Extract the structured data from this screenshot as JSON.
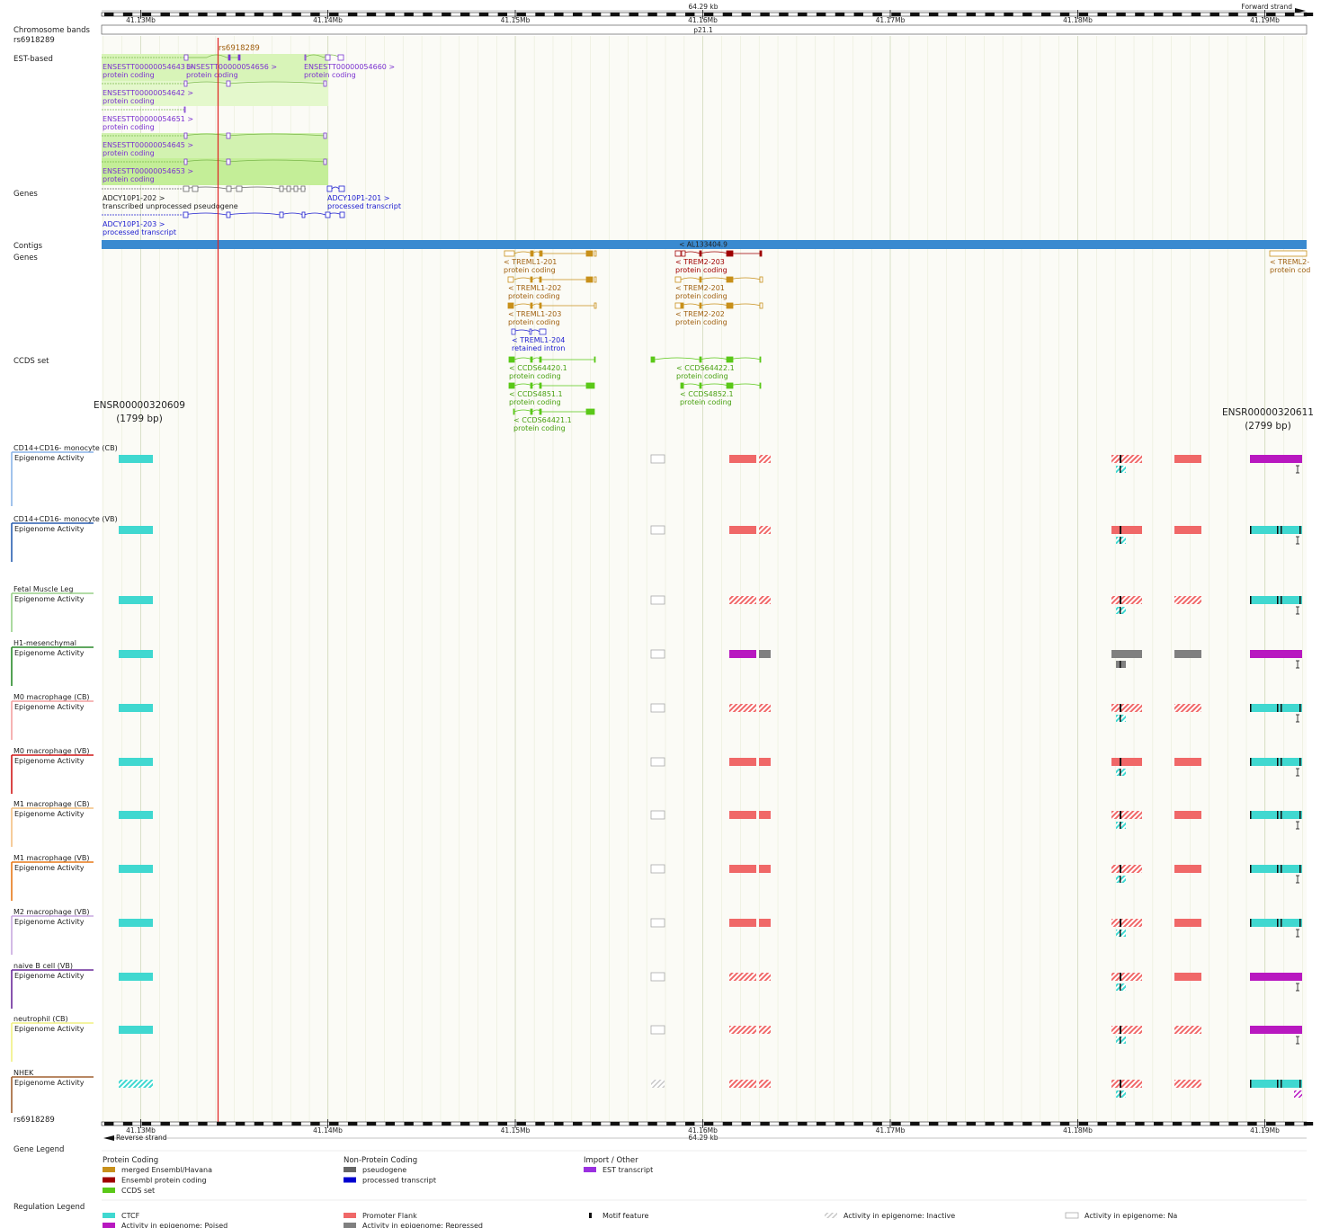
{
  "region": {
    "length_label": "64.29 kb",
    "forward_strand": "Forward strand",
    "reverse_strand": "Reverse strand",
    "band": "p21.1",
    "ticks": [
      "41.13Mb",
      "41.14Mb",
      "41.15Mb",
      "41.16Mb",
      "41.17Mb",
      "41.18Mb",
      "41.19Mb"
    ],
    "variant": "rs6918289"
  },
  "track_labels": {
    "chromosome_bands": "Chromosome bands",
    "variant": "rs6918289",
    "est": "EST-based",
    "genes": "Genes",
    "contigs": "Contigs",
    "genes2": "Genes",
    "ccds": "CCDS set",
    "variant_bottom": "rs6918289",
    "gene_legend": "Gene Legend",
    "reg_legend": "Regulation Legend",
    "epigenome_activity": "Epigenome Activity"
  },
  "est_features": [
    {
      "name": "ENSESTT00000054643 >",
      "type": "protein coding"
    },
    {
      "name": "ENSESTT00000054656 >",
      "type": "protein coding"
    },
    {
      "name": "ENSESTT00000054660 >",
      "type": "protein coding"
    },
    {
      "name": "ENSESTT00000054642 >",
      "type": "protein coding"
    },
    {
      "name": "ENSESTT00000054651 >",
      "type": "protein coding"
    },
    {
      "name": "ENSESTT00000054645 >",
      "type": "protein coding"
    },
    {
      "name": "ENSESTT00000054653 >",
      "type": "protein coding"
    }
  ],
  "genes_top": [
    {
      "name": "ADCY10P1-202 >",
      "type": "transcribed unprocessed pseudogene"
    },
    {
      "name": "ADCY10P1-201 >",
      "type": "processed transcript"
    },
    {
      "name": "ADCY10P1-203 >",
      "type": "processed transcript"
    }
  ],
  "contig": "< AL133404.9",
  "genes_bottom": [
    {
      "name": "< TREML1-201",
      "type": "protein coding"
    },
    {
      "name": "< TREML1-202",
      "type": "protein coding"
    },
    {
      "name": "< TREML1-203",
      "type": "protein coding"
    },
    {
      "name": "< TREML1-204",
      "type": "retained intron"
    },
    {
      "name": "< TREM2-203",
      "type": "protein coding"
    },
    {
      "name": "< TREM2-201",
      "type": "protein coding"
    },
    {
      "name": "< TREM2-202",
      "type": "protein coding"
    },
    {
      "name": "< TREML2-",
      "type": "protein cod"
    }
  ],
  "ccds": [
    {
      "name": "< CCDS64420.1",
      "type": "protein coding"
    },
    {
      "name": "< CCDS4851.1",
      "type": "protein coding"
    },
    {
      "name": "< CCDS64421.1",
      "type": "protein coding"
    },
    {
      "name": "< CCDS64422.1",
      "type": "protein coding"
    },
    {
      "name": "< CCDS4852.1",
      "type": "protein coding"
    }
  ],
  "regfeatures": [
    {
      "id": "ENSR00000320609",
      "size": "(1799 bp)"
    },
    {
      "id": "ENSR00000320611",
      "size": "(2799 bp)"
    }
  ],
  "epigenomes": [
    {
      "name": "CD14+CD16- monocyte (CB)",
      "color": "#8ab4e8"
    },
    {
      "name": "CD14+CD16- monocyte (VB)",
      "color": "#2a5fb0"
    },
    {
      "name": "Fetal Muscle Leg",
      "color": "#98d088"
    },
    {
      "name": "H1-mesenchymal",
      "color": "#2a8a2a"
    },
    {
      "name": "M0 macrophage (CB)",
      "color": "#f4a0a0"
    },
    {
      "name": "M0 macrophage (VB)",
      "color": "#d01818"
    },
    {
      "name": "M1 macrophage (CB)",
      "color": "#f4c080"
    },
    {
      "name": "M1 macrophage (VB)",
      "color": "#e87818"
    },
    {
      "name": "M2 macrophage (VB)",
      "color": "#c8a8e0"
    },
    {
      "name": "naive B cell (VB)",
      "color": "#6a2a9a"
    },
    {
      "name": "neutrophil (CB)",
      "color": "#f0f080"
    },
    {
      "name": "NHEK",
      "color": "#a06030"
    }
  ],
  "gene_legend": {
    "protein_coding": {
      "title": "Protein Coding",
      "items": [
        {
          "label": "merged Ensembl/Havana",
          "color": "#c8901a"
        },
        {
          "label": "Ensembl protein coding",
          "color": "#a00000"
        },
        {
          "label": "CCDS set",
          "color": "#5ac818"
        }
      ]
    },
    "non_protein_coding": {
      "title": "Non-Protein Coding",
      "items": [
        {
          "label": "pseudogene",
          "color": "#666666"
        },
        {
          "label": "processed transcript",
          "color": "#0000d0"
        }
      ]
    },
    "import_other": {
      "title": "Import / Other",
      "items": [
        {
          "label": "EST transcript",
          "color": "#9a30e0"
        }
      ]
    }
  },
  "reg_legend": [
    {
      "label": "CTCF",
      "color": "#40d8d0"
    },
    {
      "label": "Promoter Flank",
      "color": "#f06868"
    },
    {
      "label": "Motif feature",
      "color": "#111111"
    },
    {
      "label": "Activity in epigenome: Inactive",
      "color": "#c8c8c8"
    },
    {
      "label": "Activity in epigenome: Na",
      "color": "#ffffff"
    },
    {
      "label": "Activity in epigenome: Poised",
      "color": "#b818c0"
    },
    {
      "label": "Activity in epigenome: Repressed",
      "color": "#808080"
    }
  ],
  "colors": {
    "variant_line": "#e02020",
    "contig": "#3a8ad0",
    "est_bg": "#d8f4b8",
    "est_bg_dark": "#c4ee98",
    "merged": "#c8901a",
    "ensembl": "#a00000",
    "ccds": "#5ac818",
    "processed": "#2020d0",
    "est": "#8830e0",
    "ctcf": "#40d8d0",
    "flank": "#f06868",
    "poised": "#b818c0",
    "repressed": "#808080",
    "text_brown": "#a06010"
  },
  "epigenome_states": [
    [
      "ctcf",
      "na",
      "flank",
      "flank-h",
      "mix",
      "flank",
      "poised"
    ],
    [
      "ctcf",
      "na",
      "flank",
      "flank-h",
      "mix-solid",
      "flank",
      "ctcf-m"
    ],
    [
      "ctcf",
      "na",
      "flank-h",
      "flank-h",
      "mix",
      "flank-h",
      "ctcf-m"
    ],
    [
      "ctcf",
      "na",
      "poised",
      "repressed",
      "repressed",
      "repressed",
      "poised"
    ],
    [
      "ctcf",
      "na",
      "flank-h",
      "flank-h",
      "mix",
      "flank-h",
      "ctcf-m"
    ],
    [
      "ctcf",
      "na",
      "flank",
      "flank",
      "mix-solid",
      "flank",
      "ctcf-m"
    ],
    [
      "ctcf",
      "na",
      "flank",
      "flank",
      "mix",
      "flank",
      "ctcf-m"
    ],
    [
      "ctcf",
      "na",
      "flank",
      "flank",
      "mix",
      "flank",
      "ctcf-m"
    ],
    [
      "ctcf",
      "na",
      "flank",
      "flank",
      "mix",
      "flank",
      "ctcf-m"
    ],
    [
      "ctcf",
      "na",
      "flank-h",
      "flank-h",
      "mix",
      "flank",
      "poised"
    ],
    [
      "ctcf",
      "na",
      "flank-h",
      "flank-h",
      "mix",
      "flank-h",
      "poised"
    ],
    [
      "ctcf-h",
      "inactive",
      "flank-h",
      "flank-h",
      "mix",
      "flank-h",
      "ctcf-m"
    ]
  ]
}
